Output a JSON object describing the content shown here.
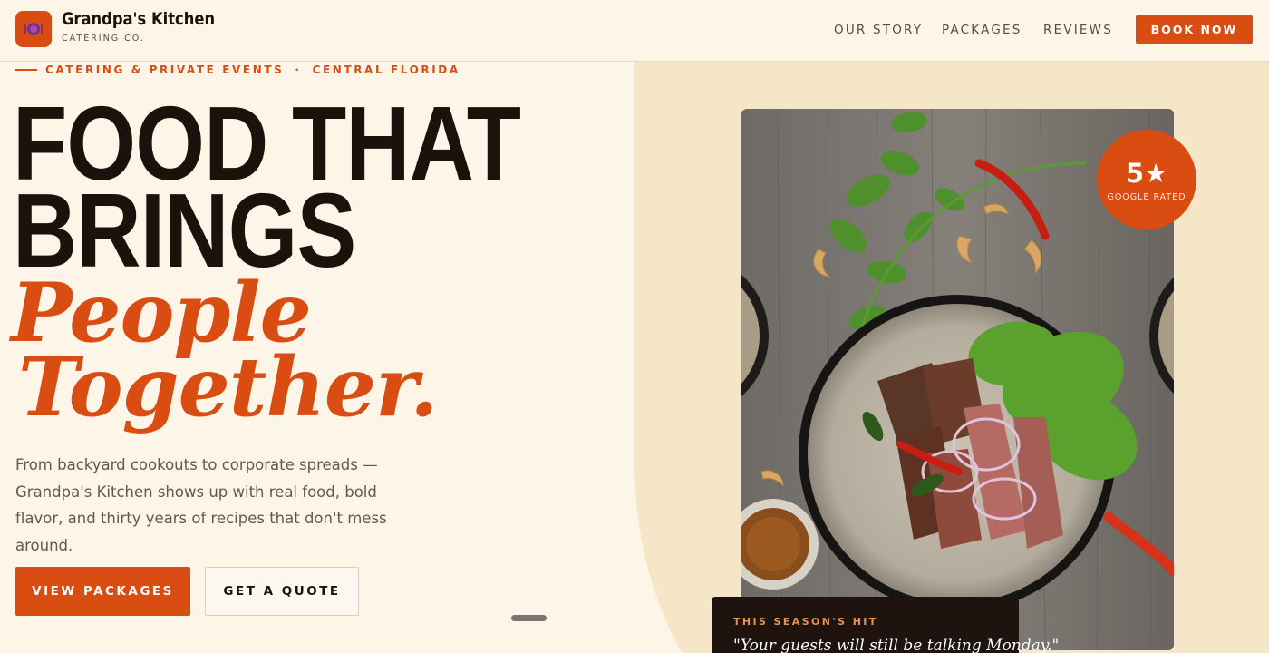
{
  "header": {
    "brand_name": "Grandpa's Kitchen",
    "brand_sub": "CATERING CO.",
    "nav": [
      "OUR STORY",
      "PACKAGES",
      "REVIEWS"
    ],
    "cta": "BOOK NOW"
  },
  "hero": {
    "eyebrow_left": "CATERING & PRIVATE EVENTS",
    "eyebrow_sep": "·",
    "eyebrow_right": "CENTRAL FLORIDA",
    "headline_line1": "FOOD THAT",
    "headline_line2": "BRINGS",
    "headline_line3": "People",
    "headline_line4": "Together.",
    "lead": "From backyard cookouts to corporate spreads — Grandpa's Kitchen shows up with real food, bold flavor, and thirty years of recipes that don't mess around.",
    "primary_button": "VIEW PACKAGES",
    "secondary_button": "GET A QUOTE"
  },
  "badge": {
    "rating": "5★",
    "label": "GOOGLE RATED"
  },
  "quote_card": {
    "eyebrow": "THIS SEASON'S HIT",
    "quote": "\"Your guests will still be talking Monday.\""
  },
  "colors": {
    "accent": "#d94d12",
    "background": "#fdf5e8",
    "panel": "#f6e6c8",
    "ink": "#1c120c"
  }
}
